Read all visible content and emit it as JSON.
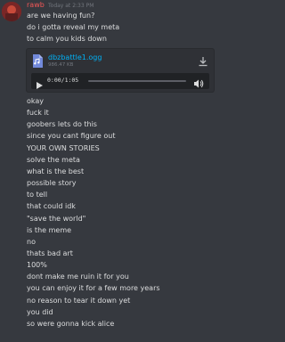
{
  "message": {
    "username": "rawb",
    "timestamp": "Today at 2:33 PM",
    "lines_before": [
      "are we having fun?",
      "do i gotta reveal my meta",
      "to calm you kids down"
    ],
    "attachment": {
      "file_name": "dbzbattle1.ogg",
      "file_size": "986.47 KB",
      "current_time": "0:00",
      "duration": "1:05",
      "time_display": "0:00/1:05",
      "progress": 0
    },
    "lines_after": [
      "okay",
      "fuck it",
      "goobers lets do this",
      "since you cant figure out",
      "YOUR OWN STORIES",
      "solve the meta",
      "what is the best",
      "possible story",
      "to tell",
      "that could idk",
      "\"save the world\"",
      "is the meme",
      "no",
      "thats bad art",
      "100%",
      "dont make me ruin it for you",
      "you can enjoy it for a few more years",
      "no reason to tear it down yet",
      "you did",
      "so were gonna kick alice"
    ]
  },
  "colors": {
    "background": "#36393f",
    "username": "#f25757",
    "link": "#00b0f4",
    "text": "#dcddde",
    "muted": "#72767d"
  },
  "icons": {
    "avatar": "avatar",
    "file": "audio-file-icon",
    "download": "download-icon",
    "play": "play-icon",
    "volume": "volume-icon"
  }
}
